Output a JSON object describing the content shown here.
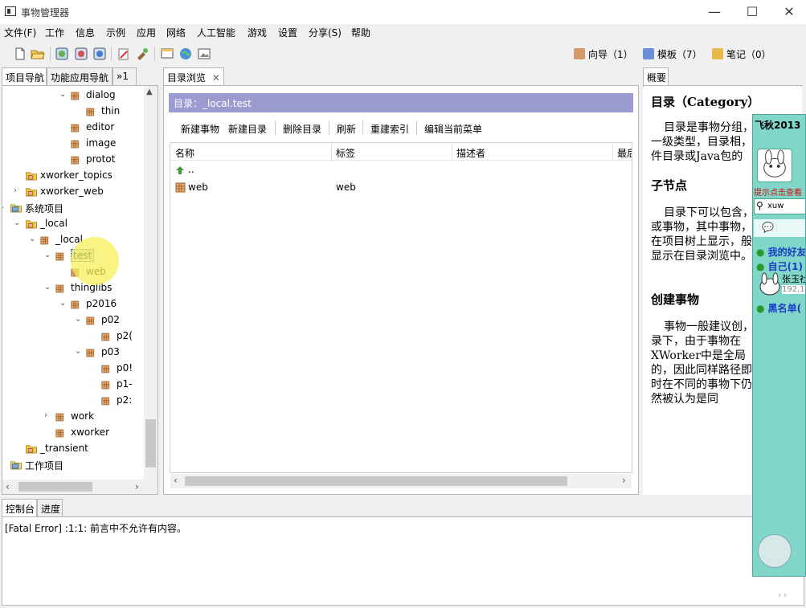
{
  "window": {
    "title": "事物管理器",
    "minimize": "—",
    "maximize": "☐",
    "close": "✕"
  },
  "menu": [
    "文件(F)",
    "工作",
    "信息",
    "示例",
    "应用",
    "网络",
    "人工智能",
    "游戏",
    "设置",
    "分享(S)",
    "帮助"
  ],
  "toolbar": {
    "wizard": "向导（1）",
    "template": "模板（7）",
    "notes": "笔记（0）"
  },
  "left_panel": {
    "tabs": [
      "项目导航",
      "功能应用导航",
      "»1"
    ],
    "tree": [
      {
        "label": "dialog",
        "indent": 5,
        "icon": "thing",
        "chev": "down"
      },
      {
        "label": "thin",
        "indent": 6,
        "icon": "thing",
        "chev": ""
      },
      {
        "label": "editor",
        "indent": 5,
        "icon": "thing",
        "chev": ""
      },
      {
        "label": "image",
        "indent": 5,
        "icon": "thing",
        "chev": ""
      },
      {
        "label": "protot",
        "indent": 5,
        "icon": "thing",
        "chev": ""
      },
      {
        "label": "xworker_topics",
        "indent": 2,
        "icon": "folder",
        "chev": ""
      },
      {
        "label": "xworker_web",
        "indent": 2,
        "icon": "folder",
        "chev": "right"
      },
      {
        "label": "系统项目",
        "indent": 1,
        "icon": "project",
        "chev": "down"
      },
      {
        "label": "_local",
        "indent": 2,
        "icon": "folder",
        "chev": "down"
      },
      {
        "label": "_local",
        "indent": 3,
        "icon": "thing",
        "chev": "down"
      },
      {
        "label": "test",
        "indent": 4,
        "icon": "thing",
        "chev": "down",
        "selected": true
      },
      {
        "label": "web",
        "indent": 5,
        "icon": "thing",
        "chev": ""
      },
      {
        "label": "thinglibs",
        "indent": 4,
        "icon": "thing",
        "chev": "down"
      },
      {
        "label": "p2016",
        "indent": 5,
        "icon": "thing",
        "chev": "down"
      },
      {
        "label": "p02",
        "indent": 6,
        "icon": "thing",
        "chev": "down"
      },
      {
        "label": "p2(",
        "indent": 7,
        "icon": "thing",
        "chev": ""
      },
      {
        "label": "p03",
        "indent": 6,
        "icon": "thing",
        "chev": "down"
      },
      {
        "label": "p0!",
        "indent": 7,
        "icon": "thing",
        "chev": ""
      },
      {
        "label": "p1-",
        "indent": 7,
        "icon": "thing",
        "chev": ""
      },
      {
        "label": "p2:",
        "indent": 7,
        "icon": "thing",
        "chev": ""
      },
      {
        "label": "work",
        "indent": 4,
        "icon": "thing",
        "chev": "right"
      },
      {
        "label": "xworker",
        "indent": 4,
        "icon": "thing",
        "chev": ""
      },
      {
        "label": "_transient",
        "indent": 2,
        "icon": "folder",
        "chev": ""
      },
      {
        "label": "工作项目",
        "indent": 1,
        "icon": "project",
        "chev": ""
      }
    ]
  },
  "center_panel": {
    "tab": "目录浏览",
    "dir_label": "目录：_local.test",
    "actions": [
      "新建事物",
      "新建目录",
      "删除目录",
      "刷新",
      "重建索引",
      "编辑当前菜单"
    ],
    "columns": [
      "名称",
      "标签",
      "描述者",
      "最后"
    ],
    "rows": [
      {
        "name": "..",
        "label": "",
        "icon": "up"
      },
      {
        "name": "web",
        "label": "web",
        "icon": "thing"
      }
    ]
  },
  "right_panel": {
    "tab": "概要",
    "h1": "目录（Category）",
    "p1": "目录是事物分组，一级类型，目录相，件目录或Java包的",
    "h2": "子节点",
    "p2": "目录下可以包含，或事物，其中事物，在项目树上显示，般显示在目录浏览中。",
    "h3": "创建事物",
    "p3": "事物一般建议创，录下，由于事物在XWorker中是全局的，因此同样路径即时在不同的事物下仍然被认为是同"
  },
  "chat": {
    "title": "飞秋2013",
    "hint": "提示点击查看",
    "search": "xuw",
    "groups": [
      "我的好友",
      "自己(1)",
      "黑名单("
    ],
    "user": "张玉社",
    "ip": "192.1"
  },
  "console": {
    "tabs": [
      "控制台",
      "进度"
    ],
    "text": "[Fatal Error] :1:1: 前言中不允许有内容。"
  },
  "colors": {
    "dir_header": "#9b9bd1",
    "selection": "#cce8ff",
    "highlight": "#f5ef5a",
    "chat_bg": "#7fd6c9"
  }
}
